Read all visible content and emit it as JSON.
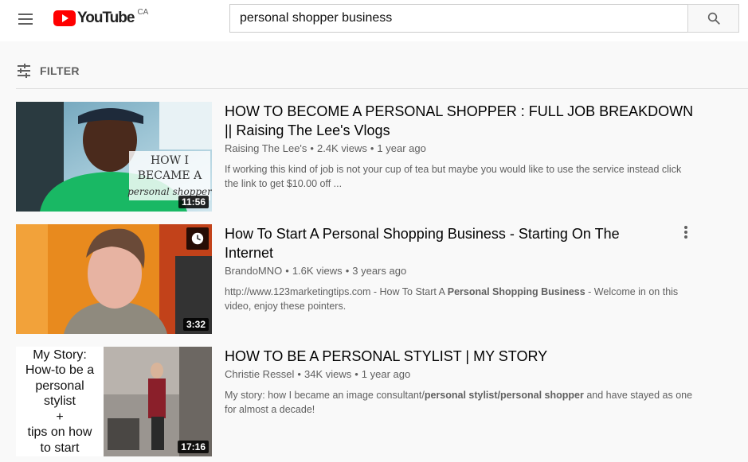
{
  "header": {
    "logo_text": "YouTube",
    "logo_region": "CA",
    "search_value": "personal shopper business"
  },
  "filter": {
    "label": "FILTER"
  },
  "results": [
    {
      "title_line1": "HOW TO BECOME A PERSONAL SHOPPER : FULL JOB BREAKDOWN",
      "title_line2": "|| Raising The Lee's Vlogs",
      "channel": "Raising The Lee's",
      "views": "2.4K views",
      "age": "1 year ago",
      "desc_line1": "If working this kind of job is not your cup of tea but maybe you would like to use the service instead click",
      "desc_line2": "the link to get $10.00 off ...",
      "duration": "11:56",
      "thumb_text": [
        "HOW I",
        "BECAME A",
        "personal shopper"
      ]
    },
    {
      "title_line1": "How To Start A Personal Shopping Business - Starting On The",
      "title_line2": "Internet",
      "channel": "BrandoMNO",
      "views": "1.6K views",
      "age": "3 years ago",
      "desc_pre": "http://www.123marketingtips.com - How To Start A ",
      "desc_bold": "Personal Shopping Business",
      "desc_post": " - Welcome in on this",
      "desc_line2": "video, enjoy these pointers.",
      "duration": "3:32"
    },
    {
      "title_line1": "HOW TO BE A PERSONAL STYLIST | MY STORY",
      "channel": "Christie Ressel",
      "views": "34K views",
      "age": "1 year ago",
      "desc_pre": "My story: how I became an image consultant/",
      "desc_bold": "personal stylist/personal shopper",
      "desc_post": " and have stayed as one",
      "desc_line2": "for almost a decade!",
      "duration": "17:16",
      "thumb_lines": [
        "My Story:",
        "How-to be a",
        "personal",
        "stylist",
        "+",
        "tips on how",
        "to start"
      ]
    }
  ],
  "colors": {
    "brand_red": "#ff0000",
    "background": "#f9f9f9",
    "meta_text": "#606060"
  }
}
